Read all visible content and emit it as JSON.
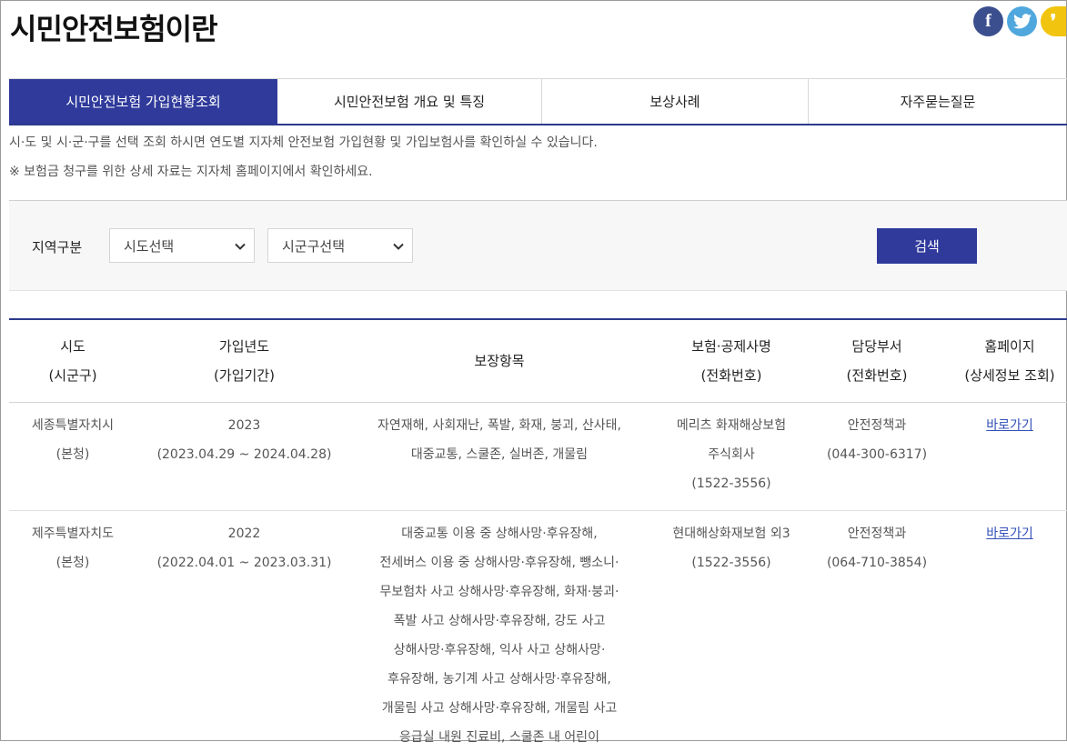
{
  "page": {
    "title": "시민안전보험이란"
  },
  "share": {
    "facebook": "f",
    "twitter": "t",
    "kakao": "❜"
  },
  "tabs": [
    "시민안전보험 가입현황조회",
    "시민안전보험 개요 및 특징",
    "보상사례",
    "자주묻는질문"
  ],
  "notices": [
    "시·도 및 시·군·구를 선택 조회 하시면 연도별 지자체 안전보험 가입현황 및 가입보험사를 확인하실 수 있습니다.",
    "※ 보험금 청구를 위한 상세 자료는 지자체 홈페이지에서 확인하세요."
  ],
  "search": {
    "label": "지역구분",
    "sido": "시도선택",
    "sigungu": "시군구선택",
    "button": "검색"
  },
  "table": {
    "headers": [
      {
        "l1": "시도",
        "l2": "(시군구)"
      },
      {
        "l1": "가입년도",
        "l2": "(가입기간)"
      },
      {
        "l1": "보장항목",
        "l2": ""
      },
      {
        "l1": "보험·공제사명",
        "l2": "(전화번호)"
      },
      {
        "l1": "담당부서",
        "l2": "(전화번호)"
      },
      {
        "l1": "홈페이지",
        "l2": "(상세정보 조회)"
      }
    ],
    "rows": [
      {
        "sido": [
          "세종특별자치시",
          "(본청)"
        ],
        "year": [
          "2023",
          "(2023.04.29 ~ 2024.04.28)"
        ],
        "coverage": [
          "자연재해, 사회재난, 폭발, 화재, 붕괴, 산사태,",
          "대중교통, 스쿨존, 실버존, 개물림"
        ],
        "insurer": [
          "메리츠 화재해상보험",
          "주식회사",
          "(1522-3556)"
        ],
        "dept": [
          "안전정책과",
          "(044-300-6317)"
        ],
        "home": "바로가기"
      },
      {
        "sido": [
          "제주특별자치도",
          "(본청)"
        ],
        "year": [
          "2022",
          "(2022.04.01 ~ 2023.03.31)"
        ],
        "coverage": [
          "대중교통 이용 중 상해사망·후유장해,",
          "전세버스 이용 중 상해사망·후유장해, 뺑소니·",
          "무보험차 사고 상해사망·후유장해, 화재·붕괴·",
          "폭발 사고 상해사망·후유장해, 강도 사고",
          "상해사망·후유장해, 익사 사고 상해사망·",
          "후유장해, 농기계 사고 상해사망·후유장해,",
          "개물림 사고 상해사망·후유장해, 개물림 사고",
          "응급실 내원 진료비, 스쿨존 내 어린이"
        ],
        "insurer": [
          "현대해상화재보험 외3",
          "(1522-3556)"
        ],
        "dept": [
          "안전정책과",
          "(064-710-3854)"
        ],
        "home": "바로가기"
      }
    ]
  }
}
